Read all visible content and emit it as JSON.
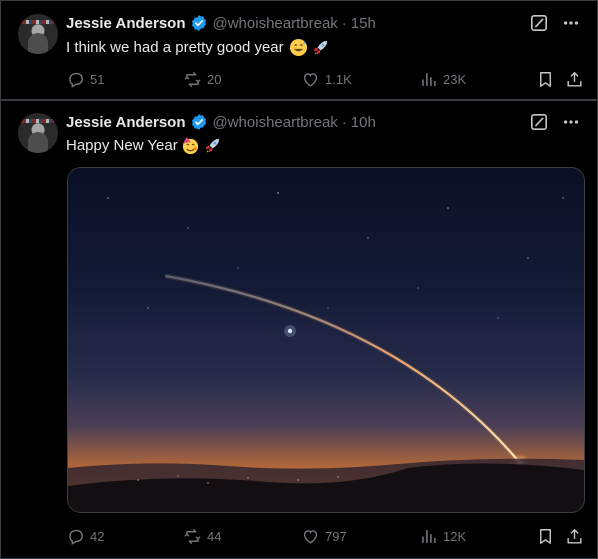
{
  "posts": [
    {
      "author_name": "Jessie Anderson",
      "handle": "@whoisheartbreak",
      "separator": "·",
      "time": "15h",
      "text": "I think we had a pretty good year",
      "emojis": [
        "grinning-sweat-emoji",
        "rocket-emoji"
      ],
      "stats": {
        "replies": "51",
        "reposts": "20",
        "likes": "1.1K",
        "views": "23K"
      }
    },
    {
      "author_name": "Jessie Anderson",
      "handle": "@whoisheartbreak",
      "separator": "·",
      "time": "10h",
      "text": "Happy New Year",
      "emojis": [
        "partying-face-emoji",
        "rocket-emoji"
      ],
      "image": "rocket-launch-trail-at-dusk",
      "stats": {
        "replies": "42",
        "reposts": "44",
        "likes": "797",
        "views": "12K"
      }
    }
  ],
  "icons": {
    "verified": "verified-badge-icon",
    "grok": "grok-icon",
    "more": "more-icon",
    "reply": "reply-icon",
    "repost": "repost-icon",
    "like": "like-icon",
    "views": "views-icon",
    "bookmark": "bookmark-icon",
    "share": "share-icon"
  },
  "colors": {
    "background": "#000000",
    "verified_blue": "#1d9bf0",
    "muted_text": "#71767b",
    "primary_text": "#e7e9ea",
    "border": "#3a3f44"
  }
}
